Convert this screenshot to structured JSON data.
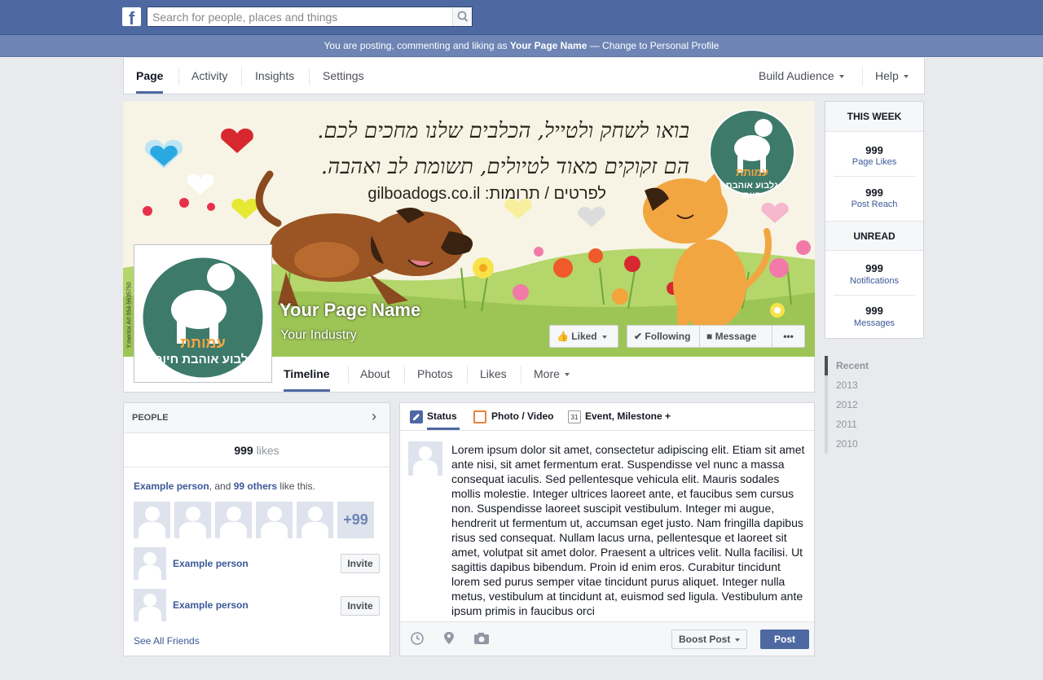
{
  "topbar": {
    "search_placeholder": "Search for people, places and things"
  },
  "notice": {
    "prefix": "You are posting, commenting and liking as ",
    "page": "Your Page Name",
    "suffix": " — Change to Personal Profile"
  },
  "navbar": {
    "tabs": [
      "Page",
      "Activity",
      "Insights",
      "Settings"
    ],
    "build_audience": "Build Audience",
    "help": "Help"
  },
  "cover": {
    "line1": "בואו לשחק ולטייל, הכלבים שלנו מחכים לכם.",
    "line2": "הם זקוקים מאוד לטיולים, תשומת לב ואהבה.",
    "line3": "לפרטים / תרומות: gilboadogs.co.il",
    "logo_top": "עמותת",
    "logo_bottom": "גלבוע אוהבת חיות",
    "side_text": "Y.mentor Art 054-5635750"
  },
  "page": {
    "name": "Your Page Name",
    "industry": "Your Industry"
  },
  "actions": {
    "liked": "Liked",
    "following": "Following",
    "message": "Message",
    "more": "•••"
  },
  "header_tabs": {
    "timeline": "Timeline",
    "about": "About",
    "photos": "Photos",
    "likes": "Likes",
    "more": "More"
  },
  "stats": {
    "this_week": "THIS WEEK",
    "page_likes": {
      "value": "999",
      "label": "Page Likes"
    },
    "post_reach": {
      "value": "999",
      "label": "Post Reach"
    },
    "unread": "UNREAD",
    "notifications": {
      "value": "999",
      "label": "Notifications"
    },
    "messages": {
      "value": "999",
      "label": "Messages"
    }
  },
  "years": [
    "Recent",
    "2013",
    "2012",
    "2011",
    "2010"
  ],
  "people": {
    "title": "PEOPLE",
    "likes_count": "999",
    "likes_word": " likes",
    "example": "Example person",
    "and_text": ", and ",
    "others": "99 others",
    "like_this": " like this.",
    "plus_count": "+99",
    "person1": "Example person",
    "person2": "Example person",
    "invite": "Invite",
    "see_all": "See All Friends"
  },
  "composer": {
    "status": "Status",
    "photo_video": "Photo / Video",
    "event": "Event, Milestone +",
    "text": "Lorem ipsum dolor sit amet, consectetur adipiscing elit. Etiam sit amet ante nisi, sit amet fermentum erat. Suspendisse vel nunc a massa consequat iaculis. Sed pellentesque vehicula elit. Mauris sodales mollis molestie. Integer ultrices laoreet ante, et faucibus sem cursus non. Suspendisse laoreet suscipit vestibulum. Integer mi augue, hendrerit ut fermentum ut, accumsan eget justo. Nam fringilla dapibus risus sed consequat. Nullam lacus urna, pellentesque et laoreet sit amet, volutpat sit amet dolor. Praesent a ultrices velit. Nulla facilisi. Ut sagittis dapibus bibendum. Proin id enim eros. Curabitur tincidunt lorem sed purus semper vitae tincidunt purus aliquet. Integer nulla metus, vestibulum at tincidunt at, euismod sed ligula. Vestibulum ante ipsum primis in faucibus orci",
    "boost": "Boost Post",
    "post": "Post",
    "calendar_day": "31"
  },
  "colors": {
    "brand": "#4e69a2",
    "link": "#3b5998",
    "teal": "#3d7a6a"
  }
}
